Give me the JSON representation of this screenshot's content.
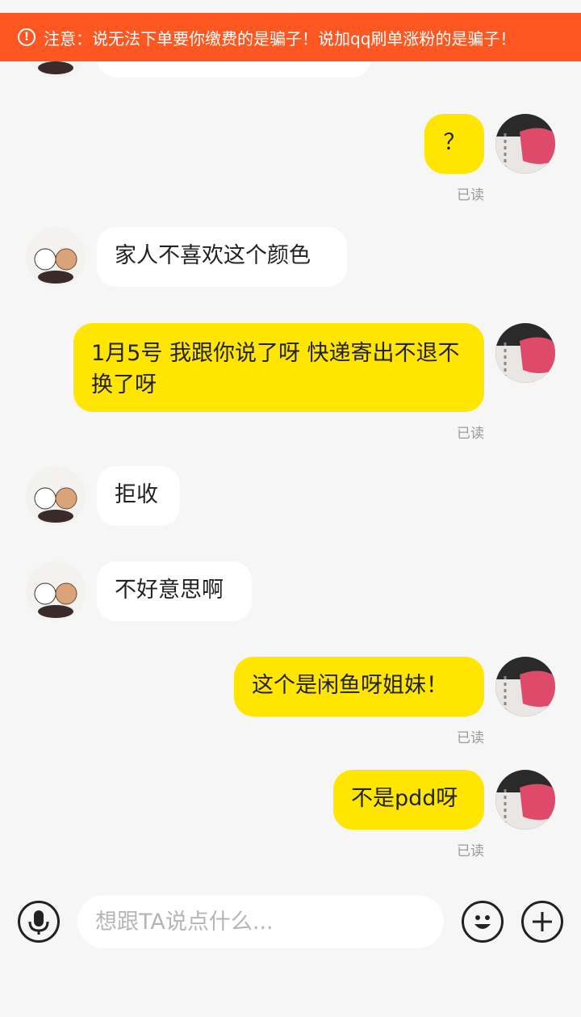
{
  "warning": {
    "icon": "alert-circle-icon",
    "icon_glyph": "!",
    "text": "注意：说无法下单要你缴费的是骗子！说加qq刷单涨粉的是骗子！",
    "background": "#ff5722"
  },
  "colors": {
    "outgoing_bubble": "#ffe600",
    "incoming_bubble": "#ffffff",
    "background": "#f6f6f6",
    "read_receipt": "#9a9a9a"
  },
  "messages": [
    {
      "side": "out",
      "text": "？",
      "read": "已读"
    },
    {
      "side": "in",
      "text": "家人不喜欢这个颜色"
    },
    {
      "side": "out",
      "text": "1月5号 我跟你说了呀 快递寄出不退不换了呀",
      "read": "已读"
    },
    {
      "side": "in",
      "text": "拒收"
    },
    {
      "side": "in",
      "text": "不好意思啊"
    },
    {
      "side": "out",
      "text": "这个是闲鱼呀姐妹！",
      "read": "已读"
    },
    {
      "side": "out",
      "text": "不是pdd呀",
      "read": "已读"
    }
  ],
  "input_bar": {
    "mic_icon": "microphone-icon",
    "placeholder": "想跟TA说点什么...",
    "emoji_icon": "smiley-icon",
    "plus_icon": "plus-icon"
  }
}
